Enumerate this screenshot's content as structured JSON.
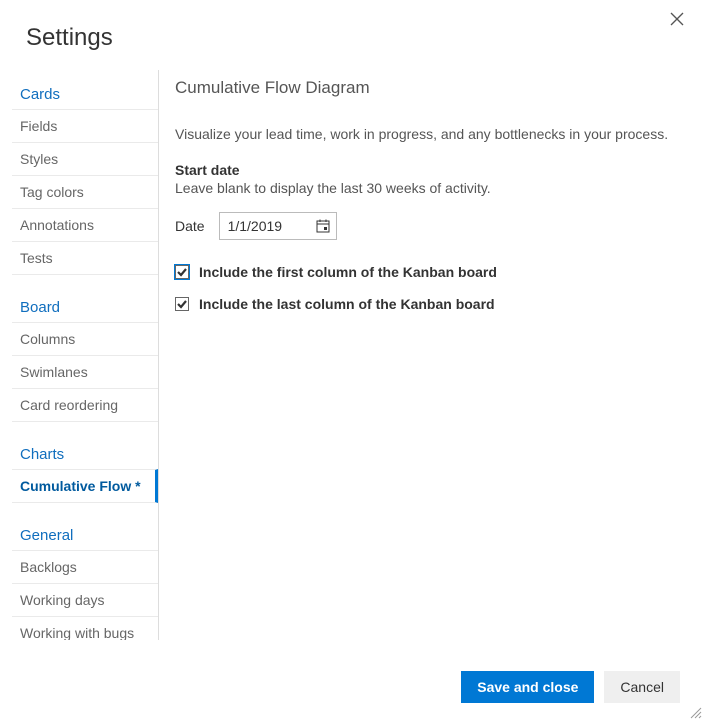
{
  "title": "Settings",
  "sidebar": {
    "groups": [
      {
        "header": "Cards",
        "items": [
          {
            "label": "Fields",
            "active": false
          },
          {
            "label": "Styles",
            "active": false
          },
          {
            "label": "Tag colors",
            "active": false
          },
          {
            "label": "Annotations",
            "active": false
          },
          {
            "label": "Tests",
            "active": false
          }
        ]
      },
      {
        "header": "Board",
        "items": [
          {
            "label": "Columns",
            "active": false
          },
          {
            "label": "Swimlanes",
            "active": false
          },
          {
            "label": "Card reordering",
            "active": false
          }
        ]
      },
      {
        "header": "Charts",
        "items": [
          {
            "label": "Cumulative Flow *",
            "active": true
          }
        ]
      },
      {
        "header": "General",
        "items": [
          {
            "label": "Backlogs",
            "active": false
          },
          {
            "label": "Working days",
            "active": false
          },
          {
            "label": "Working with bugs",
            "active": false
          }
        ]
      }
    ]
  },
  "main": {
    "heading": "Cumulative Flow Diagram",
    "description": "Visualize your lead time, work in progress, and any bottlenecks in your process.",
    "start_date_label": "Start date",
    "start_date_hint": "Leave blank to display the last 30 weeks of activity.",
    "date_label": "Date",
    "date_value": "1/1/2019",
    "checkbox1": {
      "checked": true,
      "highlight": true,
      "label": "Include the first column of the Kanban board"
    },
    "checkbox2": {
      "checked": true,
      "highlight": false,
      "label": "Include the last column of the Kanban board"
    }
  },
  "footer": {
    "primary": "Save and close",
    "secondary": "Cancel"
  }
}
